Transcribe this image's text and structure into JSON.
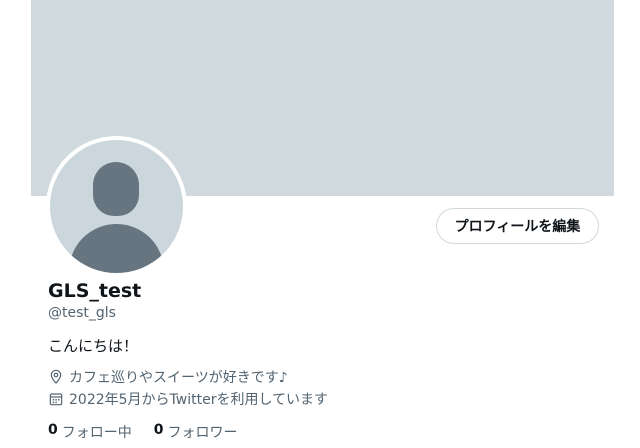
{
  "profile": {
    "display_name": "GLS_test",
    "handle": "@test_gls",
    "bio": "こんにちは！",
    "location": "カフェ巡りやスイーツが好きです♪",
    "joined": "2022年5月からTwitterを利用しています",
    "edit_button_label": "プロフィールを編集"
  },
  "stats": {
    "following_count": "0",
    "following_label": "フォロー中",
    "followers_count": "0",
    "followers_label": "フォロワー"
  },
  "icons": {
    "location": "location-pin-icon",
    "joined": "calendar-icon",
    "avatar": "default-avatar-icon"
  },
  "colors": {
    "banner": "#cfd9de",
    "avatar_bg": "#ccd6dd",
    "avatar_figure": "#66757f",
    "primary_text": "#0f1419",
    "secondary_text": "#536471",
    "button_border": "#cfd9de"
  }
}
